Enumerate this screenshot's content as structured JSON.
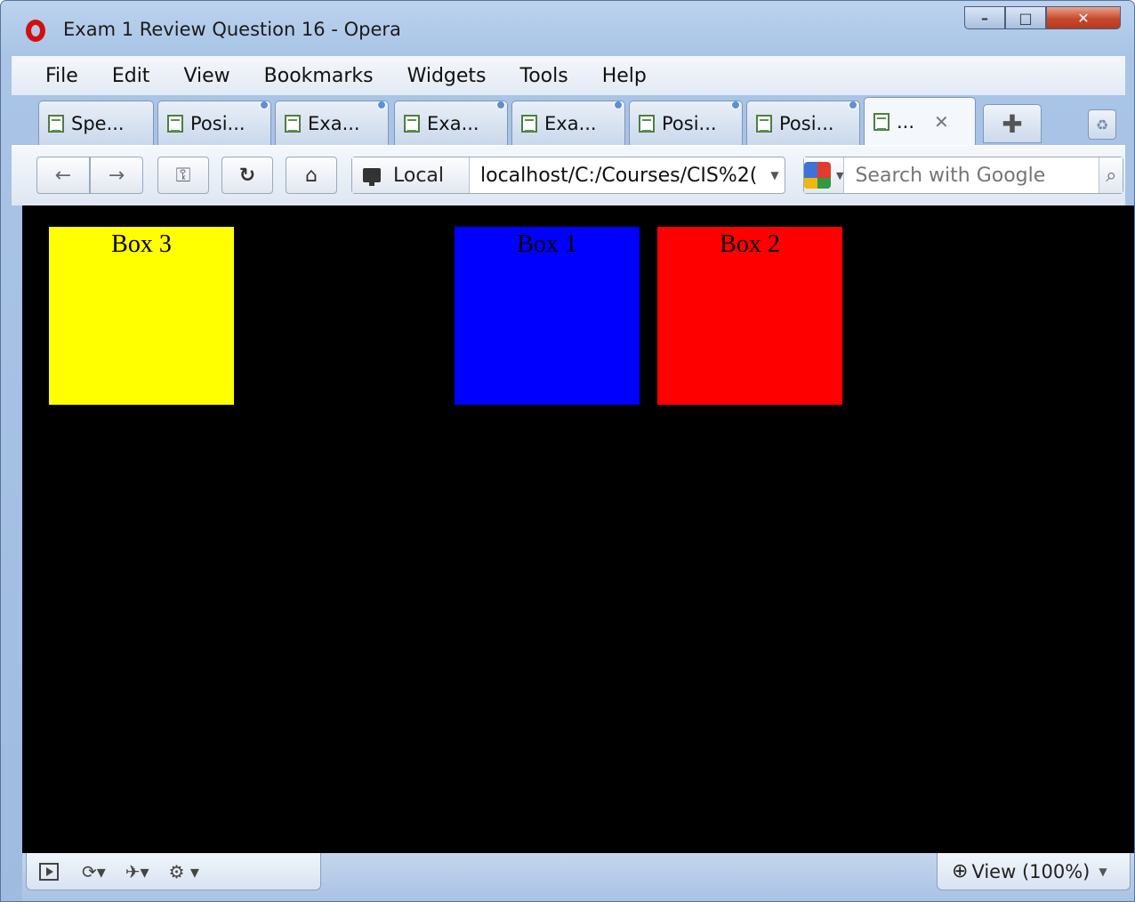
{
  "window": {
    "title": "Exam 1 Review Question 16 - Opera"
  },
  "menu": [
    "File",
    "Edit",
    "View",
    "Bookmarks",
    "Widgets",
    "Tools",
    "Help"
  ],
  "tabs": [
    {
      "label": "Spe..."
    },
    {
      "label": "Posi..."
    },
    {
      "label": "Exa..."
    },
    {
      "label": "Exa..."
    },
    {
      "label": "Exa..."
    },
    {
      "label": "Posi..."
    },
    {
      "label": "Posi..."
    },
    {
      "label": "..."
    }
  ],
  "address": {
    "local_label": "Local",
    "url": "localhost/C:/Courses/CIS%2("
  },
  "search": {
    "placeholder": "Search with Google"
  },
  "content": {
    "background": "#000000",
    "boxes": [
      {
        "label": "Box 3",
        "color": "#ffff00"
      },
      {
        "label": "Box 1",
        "color": "#0000ff"
      },
      {
        "label": "Box 2",
        "color": "#ff0000"
      }
    ]
  },
  "statusbar": {
    "zoom_label": "View (100%)"
  }
}
